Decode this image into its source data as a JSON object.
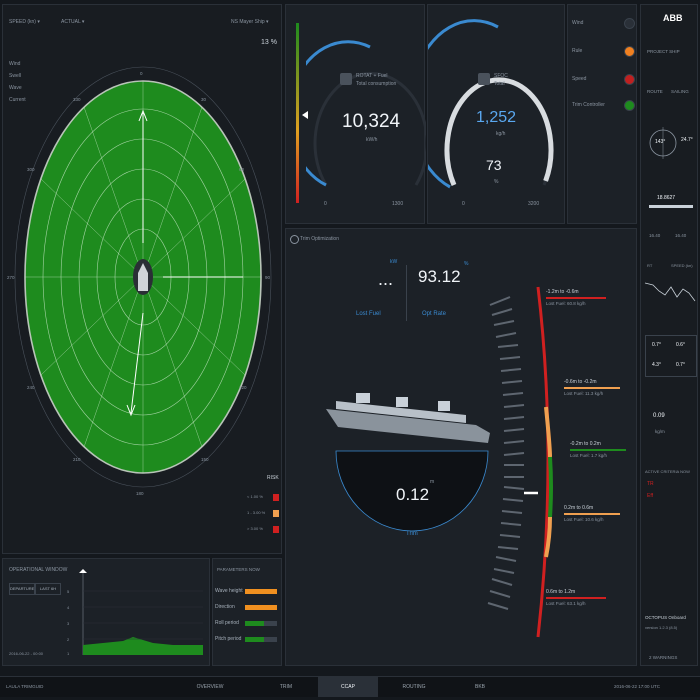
{
  "radar": {
    "mode_select": "SPEED (kn)",
    "value_select": "ACTUAL",
    "right_select": "NS Mayer Ship",
    "percent": "13 %",
    "legend": [
      {
        "label": "Wind",
        "color": "#9aa4ae"
      },
      {
        "label": "Swell",
        "color": "#9aa4ae"
      },
      {
        "label": "Wave",
        "color": "#9aa4ae"
      },
      {
        "label": "Current",
        "color": "#9aa4ae"
      }
    ],
    "risk_title": "RISK",
    "risk_items": [
      {
        "label": "< 1.00 %",
        "color": "#d02020"
      },
      {
        "label": "1 - 3.00 %",
        "color": "#f0a050"
      },
      {
        "label": "> 3.00 %",
        "color": "#d02020"
      }
    ],
    "fill_color": "#1e8b1e"
  },
  "gauge1": {
    "title": "ROTAT + Fuel",
    "subtitle": "Total consumption",
    "value": "10,324",
    "unit": "kW/h",
    "min": "0",
    "max": "1300"
  },
  "gauge2": {
    "title": "SFOC",
    "subtitle": "Total",
    "value": "1,252",
    "unit": "kg/h",
    "value2": "73",
    "unit2": "%",
    "min": "0",
    "max": "3200"
  },
  "status": {
    "items": [
      {
        "label": "Wind",
        "color": "#2a3038"
      },
      {
        "label": "Rule",
        "color": "#f08020"
      },
      {
        "label": "Speed",
        "color": "#c02020"
      },
      {
        "label": "Trim Controller",
        "color": "#1e8b1e"
      }
    ]
  },
  "brand": {
    "logo": "ABB",
    "project": "PROJECT SHIP",
    "tabs": [
      "ROUTE",
      "SAILING"
    ],
    "heading": "143°",
    "heading2": "24.7°",
    "speed_value": "18.8627",
    "speed_left": "16.40",
    "speed_right": "16.40",
    "chart_label_left": "RT",
    "chart_label_right": "SPEED (kn)",
    "grid": [
      "0.7°",
      "0.6°",
      "4.3°",
      "0.7°"
    ],
    "stat_value": "0.09",
    "stat_unit": "kg/m",
    "active_title": "ACTIVE CRITERIA NOW",
    "active_items": [
      "TR",
      "Eff"
    ],
    "onboard_title": "OCTOPUS Onboard",
    "onboard_version": "version 1.2.3 (8.5)",
    "warnings": "2 WARNINGS"
  },
  "trim": {
    "title": "Trim Optimization",
    "left_value": "...",
    "left_unit": "kW",
    "left_label": "Lost Fuel",
    "right_value": "93.12",
    "right_unit": "%",
    "right_label": "Opt Rate",
    "trim_value": "0.12",
    "trim_unit": "m",
    "trim_label": "Trim",
    "ranges": [
      {
        "range": "-1.2m to -0.6m",
        "fuel": "Lost Fuel: 60.8 kg/h",
        "color": "#d02020"
      },
      {
        "range": "-0.6m to -0.2m",
        "fuel": "Lost Fuel: 11.3 kg/h",
        "color": "#f0a050"
      },
      {
        "range": "-0.2m to 0.2m",
        "fuel": "Lost Fuel: 1.7 kg/h",
        "color": "#1e8b1e"
      },
      {
        "range": "0.2m to 0.6m",
        "fuel": "Lost Fuel: 10.6 kg/h",
        "color": "#f0a050"
      },
      {
        "range": "0.6m to 1.2m",
        "fuel": "Lost Fuel: 63.1 kg/h",
        "color": "#d02020"
      }
    ]
  },
  "window": {
    "title": "OPERATIONAL WINDOW",
    "btn1": "DEPARTURE",
    "btn2": "LAST 6H",
    "timestamp": "2016-06-22 - 00:00",
    "y_labels": [
      "5",
      "4",
      "3",
      "2",
      "1"
    ]
  },
  "params": {
    "title": "PARAMETERS NOW",
    "bars": [
      {
        "label": "Wave height",
        "color": "#f09020",
        "fraction": 1.0
      },
      {
        "label": "Direction",
        "color": "#f09020",
        "fraction": 1.0
      },
      {
        "label": "Roll period",
        "color": "#1e8b1e",
        "fraction": 0.6
      },
      {
        "label": "Pitch period",
        "color": "#1e8b1e",
        "fraction": 0.6
      }
    ]
  },
  "bottom_nav": {
    "left": "LAULA  TRIMGUID",
    "tabs": [
      "OVERVIEW",
      "TRIM",
      "CCAP",
      "ROUTING",
      "BKB"
    ],
    "right": "2016-06-22  17:00 UTC"
  }
}
